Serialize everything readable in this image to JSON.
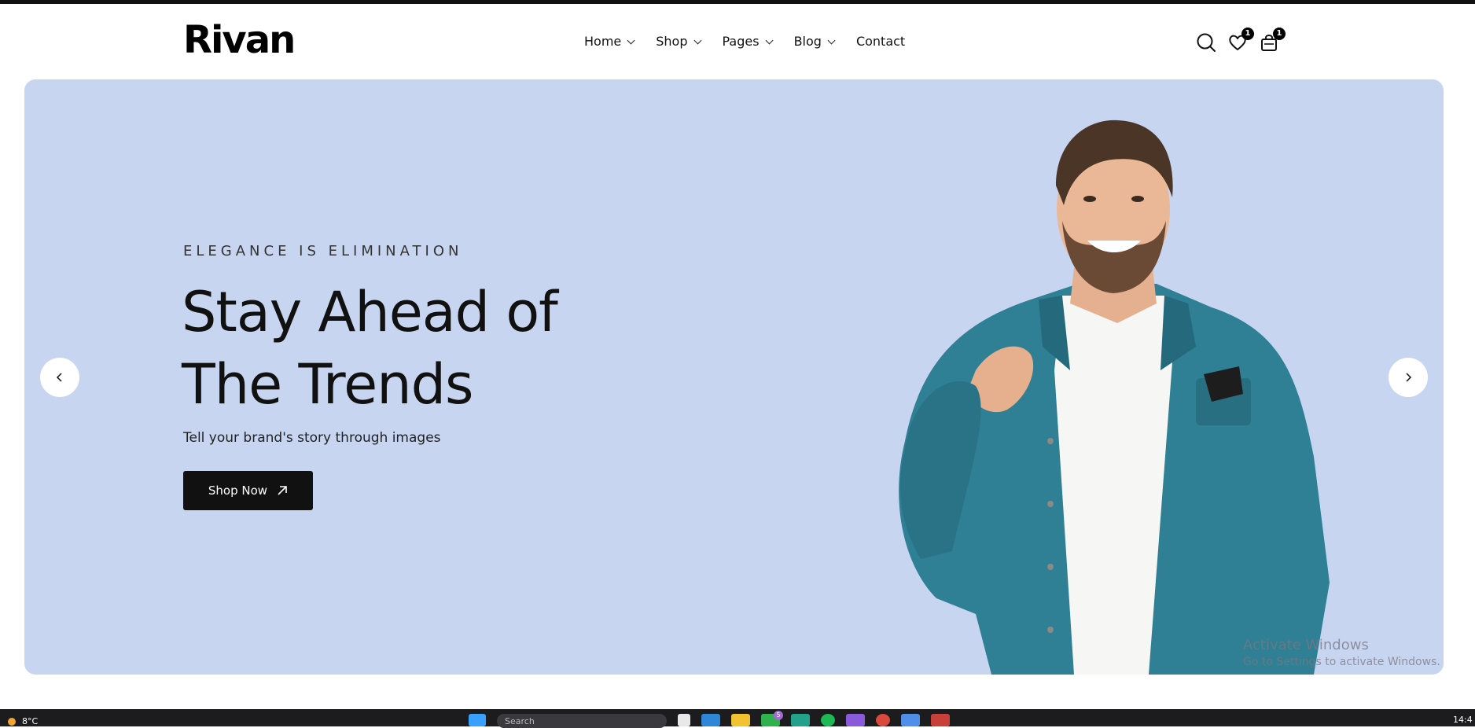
{
  "header": {
    "logo": "Rivan",
    "nav": [
      {
        "label": "Home",
        "has_dropdown": true
      },
      {
        "label": "Shop",
        "has_dropdown": true
      },
      {
        "label": "Pages",
        "has_dropdown": true
      },
      {
        "label": "Blog",
        "has_dropdown": true
      },
      {
        "label": "Contact",
        "has_dropdown": false
      }
    ],
    "icons": {
      "search": "search-icon",
      "wishlist": "heart-icon",
      "cart": "shopping-bag-icon"
    },
    "wishlist_count": "1",
    "cart_count": "1"
  },
  "hero": {
    "eyebrow": "ELEGANCE IS ELIMINATION",
    "headline_line1": "Stay Ahead of",
    "headline_line2": "The Trends",
    "subtext": "Tell your brand's story through images",
    "cta_label": "Shop Now",
    "background_color": "#c7d5f1"
  },
  "watermark": {
    "line1": "Activate Windows",
    "line2": "Go to Settings to activate Windows."
  },
  "taskbar": {
    "temperature": "8°C",
    "search_placeholder": "Search",
    "notification_count": "5",
    "clock": "14:4"
  },
  "colors": {
    "accent": "#111111",
    "hero_bg": "#c7d5f1",
    "denim": "#2f7f95"
  }
}
